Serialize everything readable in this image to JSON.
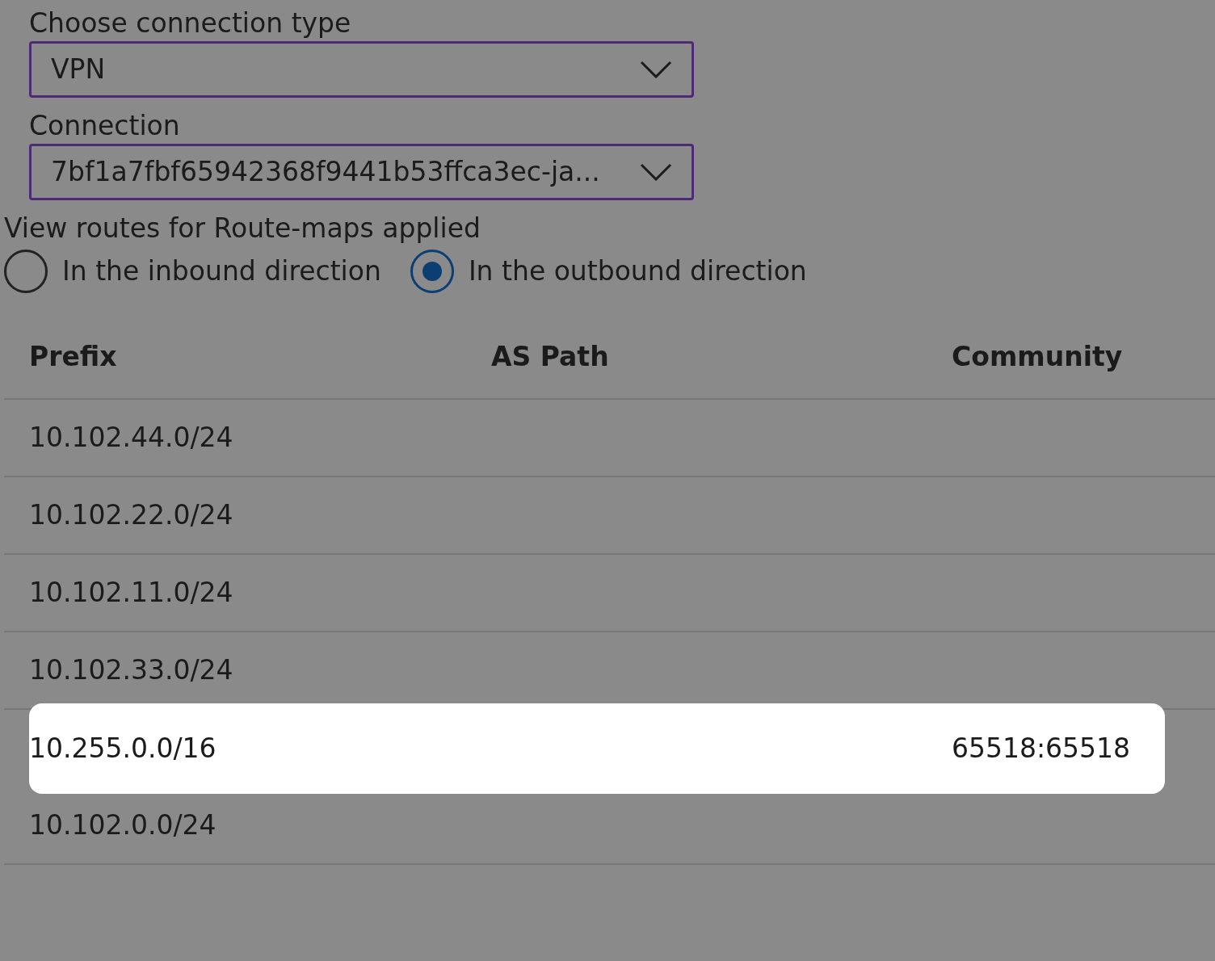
{
  "connection_type": {
    "label": "Choose connection type",
    "value": "VPN"
  },
  "connection": {
    "label": "Connection",
    "value": "7bf1a7fbf65942368f9441b53ffca3ec-ja..."
  },
  "direction": {
    "label": "View routes for Route-maps applied",
    "options": [
      {
        "label": "In the inbound direction",
        "selected": false
      },
      {
        "label": "In the outbound direction",
        "selected": true
      }
    ]
  },
  "table": {
    "columns": [
      "Prefix",
      "AS Path",
      "Community"
    ],
    "rows": [
      {
        "prefix": "10.102.44.0/24",
        "highlighted": false
      },
      {
        "prefix": "10.102.22.0/24",
        "highlighted": false
      },
      {
        "prefix": "10.102.11.0/24",
        "highlighted": false
      },
      {
        "prefix": "10.102.33.0/24",
        "highlighted": false
      },
      {
        "prefix": "10.255.0.0/16",
        "community": "65518:65518",
        "highlighted": true
      },
      {
        "prefix": "10.102.0.0/24",
        "highlighted": false
      }
    ]
  }
}
